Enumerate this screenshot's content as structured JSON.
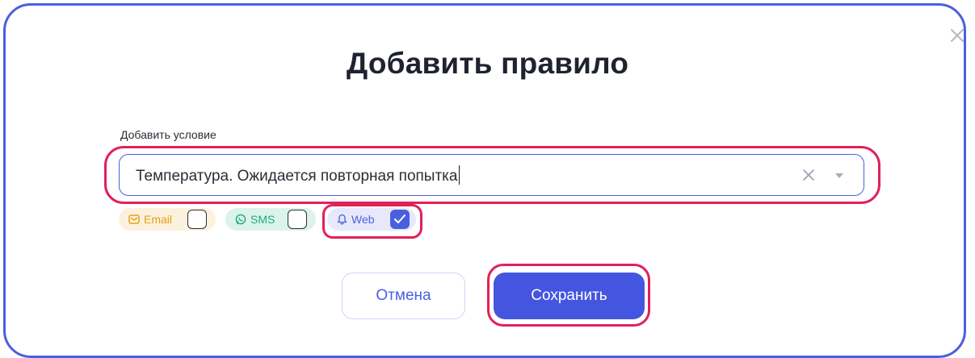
{
  "dialog": {
    "title": "Добавить правило",
    "close_icon": "close-icon"
  },
  "condition": {
    "label": "Добавить условие",
    "value": "Температура. Ожидается повторная попытка",
    "clear_icon": "clear-icon",
    "dropdown_icon": "chevron-down-icon"
  },
  "channels": [
    {
      "label": "Email",
      "icon": "mail-icon",
      "checked": false,
      "color": "#e3a316",
      "bg": "#fcf1dc"
    },
    {
      "label": "SMS",
      "icon": "chat-icon",
      "checked": false,
      "color": "#1fa883",
      "bg": "#dbf3eb"
    },
    {
      "label": "Web",
      "icon": "bell-icon",
      "checked": true,
      "color": "#4a5fe0",
      "bg": "#e7e9fb"
    }
  ],
  "buttons": {
    "cancel": "Отмена",
    "save": "Сохранить"
  },
  "colors": {
    "accent": "#4a5fe0",
    "highlight": "#e0215a"
  }
}
